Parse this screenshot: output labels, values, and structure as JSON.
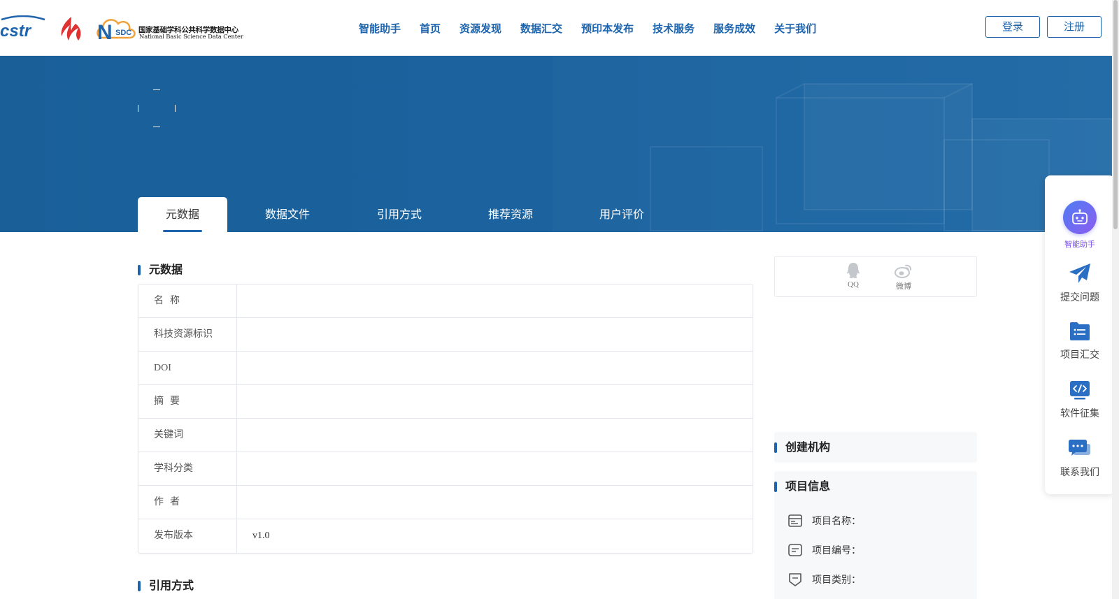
{
  "header": {
    "logo_cstr_text": "cstr",
    "logo_nsdc_text": "SDC",
    "logo_cn": "国家基础学科公共科学数据中心",
    "logo_en": "National Basic Science Data Center",
    "nav": [
      "智能助手",
      "首页",
      "资源发现",
      "数据汇交",
      "预印本发布",
      "技术服务",
      "服务成效",
      "关于我们"
    ],
    "login": "登录",
    "register": "注册"
  },
  "tabs": [
    "元数据",
    "数据文件",
    "引用方式",
    "推荐资源",
    "用户评价"
  ],
  "metadata": {
    "heading": "元数据",
    "rows": [
      {
        "key": "名称",
        "value": ""
      },
      {
        "key": "科技资源标识",
        "value": ""
      },
      {
        "key": "DOI",
        "value": ""
      },
      {
        "key": "摘要",
        "value": ""
      },
      {
        "key": "关键词",
        "value": ""
      },
      {
        "key": "学科分类",
        "value": ""
      },
      {
        "key": "作者",
        "value": ""
      },
      {
        "key": "发布版本",
        "value": "v1.0"
      }
    ]
  },
  "citation": {
    "heading": "引用方式"
  },
  "share": {
    "qq": "QQ",
    "weibo": "微博"
  },
  "org": {
    "heading": "创建机构"
  },
  "project": {
    "heading": "项目信息",
    "name_label": "项目名称：",
    "number_label": "项目编号：",
    "category_label": "项目类别："
  },
  "float_panel": {
    "assistant": "智能助手",
    "submit": "提交问题",
    "project": "项目汇交",
    "software": "软件征集",
    "contact": "联系我们"
  },
  "colors": {
    "brand": "#1d64ad",
    "banner": "#1b63a0",
    "accent_purple": "#7a52e6"
  }
}
